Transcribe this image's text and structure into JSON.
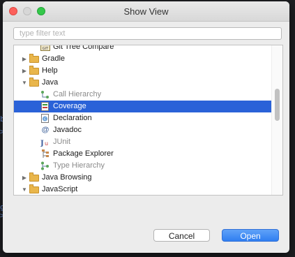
{
  "dialog": {
    "title": "Show View",
    "filter_placeholder": "type filter text",
    "buttons": {
      "cancel": "Cancel",
      "open": "Open"
    }
  },
  "tree": {
    "rows": [
      {
        "label": "Git Tree Compare",
        "icon": "git-tree-compare-icon"
      },
      {
        "label": "Gradle",
        "icon": "folder-icon"
      },
      {
        "label": "Help",
        "icon": "folder-icon"
      },
      {
        "label": "Java",
        "icon": "folder-open-icon"
      },
      {
        "label": "Call Hierarchy",
        "icon": "call-hierarchy-icon"
      },
      {
        "label": "Coverage",
        "icon": "coverage-icon"
      },
      {
        "label": "Declaration",
        "icon": "declaration-icon"
      },
      {
        "label": "Javadoc",
        "icon": "javadoc-icon"
      },
      {
        "label": "JUnit",
        "icon": "junit-icon"
      },
      {
        "label": "Package Explorer",
        "icon": "package-explorer-icon"
      },
      {
        "label": "Type Hierarchy",
        "icon": "type-hierarchy-icon"
      },
      {
        "label": "Java Browsing",
        "icon": "folder-icon"
      },
      {
        "label": "JavaScript",
        "icon": "folder-open-icon"
      }
    ]
  },
  "colors": {
    "selection": "#2a62d8",
    "primary_button": "#2f7ef1",
    "folder": "#e9b64b"
  }
}
